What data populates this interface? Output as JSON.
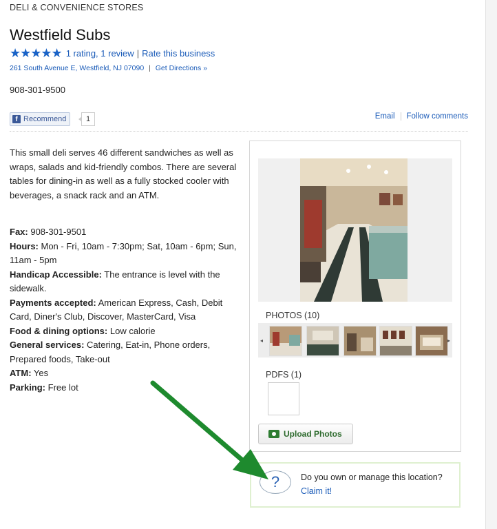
{
  "header": {
    "category": "DELI & CONVENIENCE STORES",
    "business_name": "Westfield Subs",
    "stars": "★★★★★",
    "rating_link": "1 rating, 1 review",
    "rate_link": "Rate this business",
    "address": "261 South Avenue E, Westfield, NJ 07090",
    "directions_link": "Get Directions »",
    "phone": "908-301-9500"
  },
  "social": {
    "recommend_label": "Recommend",
    "recommend_count": "1",
    "email_link": "Email",
    "follow_link": "Follow comments"
  },
  "description": "This small deli serves 46 different sandwiches as well as wraps, salads and kid-friendly combos. There are several tables for dining-in as well as a fully stocked cooler with beverages, a snack rack and an ATM.",
  "details": {
    "fax_label": "Fax:",
    "fax_value": " 908-301-9501",
    "hours_label": "Hours:",
    "hours_value": " Mon - Fri, 10am - 7:30pm; Sat, 10am - 6pm; Sun, 11am - 5pm",
    "handicap_label": "Handicap Accessible:",
    "handicap_value": " The entrance is level with the sidewalk.",
    "payments_label": "Payments accepted:",
    "payments_value": " American Express, Cash, Debit Card, Diner's Club, Discover, MasterCard, Visa",
    "food_label": "Food & dining options:",
    "food_value": " Low calorie",
    "services_label": "General services:",
    "services_value": " Catering, Eat-in, Phone orders, Prepared foods, Take-out",
    "atm_label": "ATM:",
    "atm_value": " Yes",
    "parking_label": "Parking:",
    "parking_value": " Free lot"
  },
  "media": {
    "photos_label": "PHOTOS (10)",
    "pdfs_label": "PDFS (1)",
    "upload_label": "Upload Photos",
    "arrow_left": "◂",
    "arrow_right": "▸"
  },
  "claim": {
    "icon": "?",
    "text": "Do you own or manage this location?",
    "link": "Claim it!"
  },
  "colors": {
    "link": "#1a5bb8",
    "annotation_arrow": "#1e8a2e",
    "upload_green": "#2e7d32"
  }
}
